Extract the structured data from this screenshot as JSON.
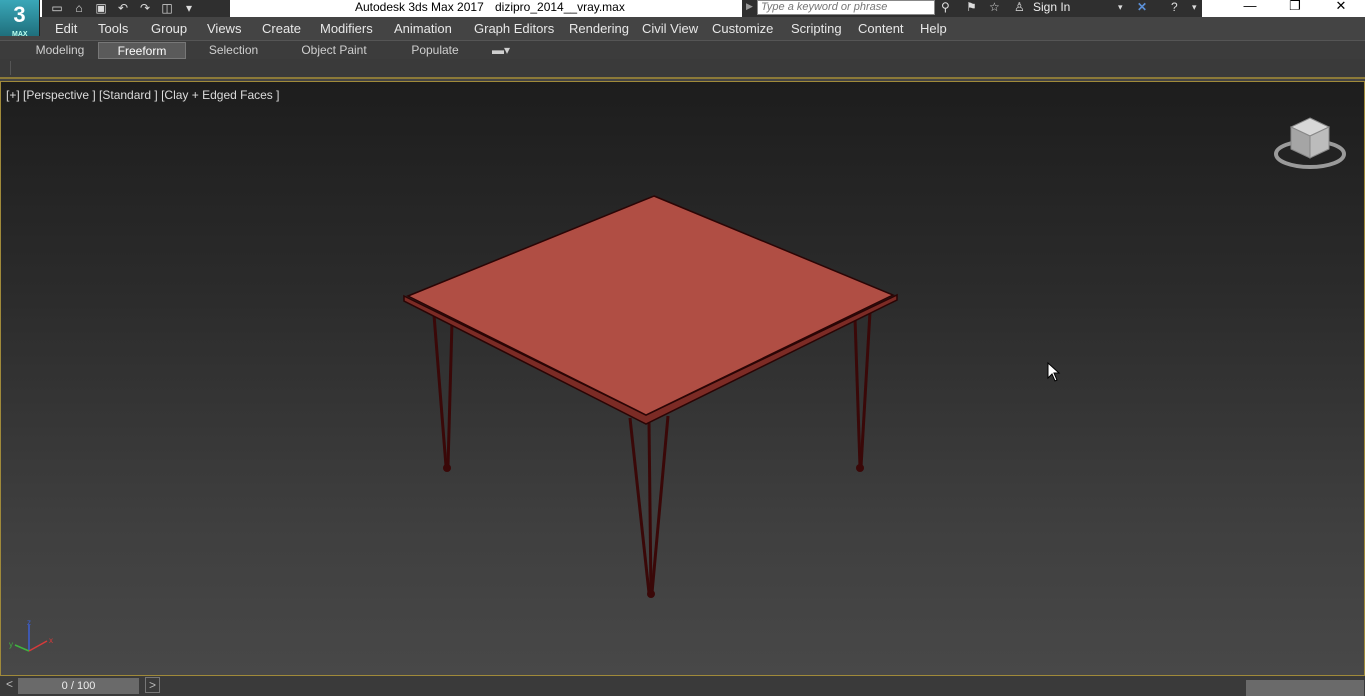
{
  "app": {
    "title": "Autodesk 3ds Max 2017",
    "file": "dizipro_2014__vray.max",
    "logo_text": "3",
    "logo_subtext": "MAX"
  },
  "quick_access": {
    "icons": [
      "new-file-icon",
      "open-file-icon",
      "save-icon",
      "undo-icon",
      "redo-icon",
      "project-icon",
      "customize-icon"
    ]
  },
  "search": {
    "placeholder": "Type a keyword or phrase"
  },
  "account": {
    "sign_in": "Sign In"
  },
  "menu": {
    "items": [
      "Edit",
      "Tools",
      "Group",
      "Views",
      "Create",
      "Modifiers",
      "Animation",
      "Graph Editors",
      "Rendering",
      "Civil View",
      "Customize",
      "Scripting",
      "Content",
      "Help"
    ]
  },
  "ribbon": {
    "tabs": [
      "Modeling",
      "Freeform",
      "Selection",
      "Object Paint",
      "Populate"
    ],
    "active_tab": "Freeform"
  },
  "viewport": {
    "label": "[+] [Perspective ] [Standard ] [Clay + Edged Faces ]",
    "background": "#2e2e2e",
    "model_color": "#b04e44",
    "edge_color": "#3a0a0a"
  },
  "timeline": {
    "frame": "0 / 100",
    "prev": "<",
    "next": ">"
  },
  "colors": {
    "accent_border": "#a08a3a",
    "menu_bg": "#444444"
  }
}
